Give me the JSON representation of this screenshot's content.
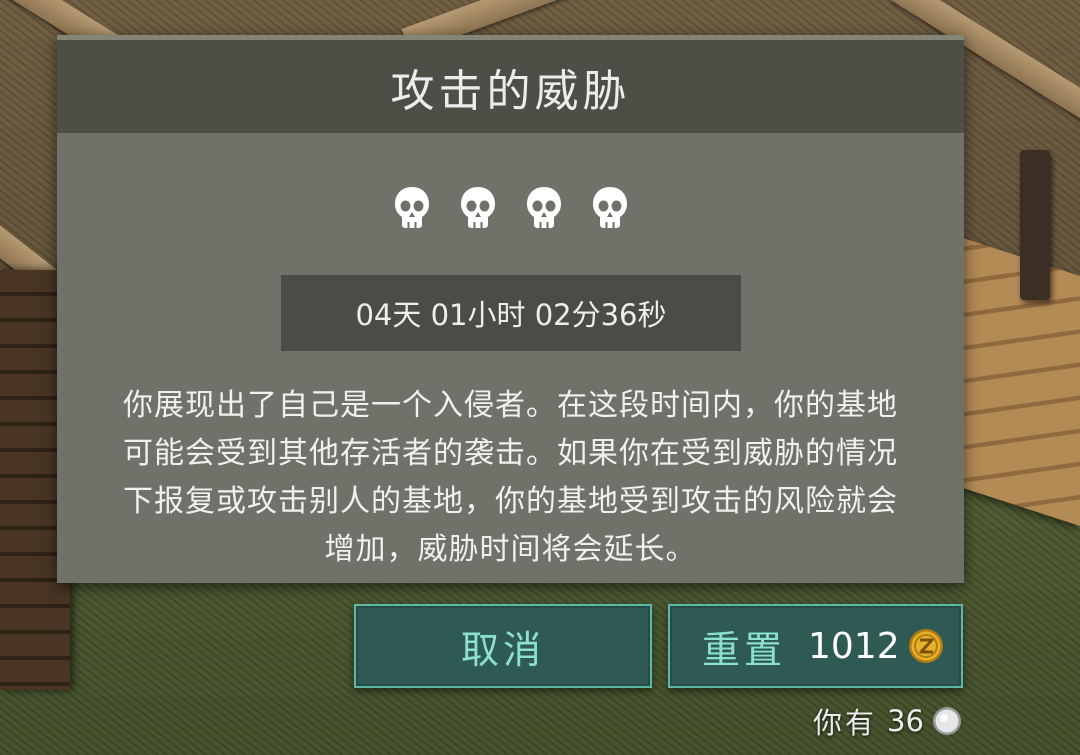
{
  "dialog": {
    "title": "攻击的威胁",
    "threat_level": 4,
    "timer": "04天 01小时 02分36秒",
    "description": "你展现出了自己是一个入侵者。在这段时间内，你的基地可能会受到其他存活者的袭击。如果你在受到威胁的情况下报复或攻击别人的基地，你的基地受到攻击的风险就会增加，威胁时间将会延长。"
  },
  "buttons": {
    "cancel_label": "取消",
    "reset_label": "重置",
    "reset_price": "1012"
  },
  "wallet": {
    "owned_label": "你有",
    "owned_value": "36"
  },
  "colors": {
    "panel": "#6f7268",
    "header": "#4c4f46",
    "button_bg": "#2e5a53",
    "button_border": "#5fb8a6",
    "button_text": "#8ce0cf",
    "coin_gold": "#e8b12a"
  },
  "icons": [
    "skull-icon",
    "gold-coin-icon",
    "silver-coin-icon"
  ]
}
